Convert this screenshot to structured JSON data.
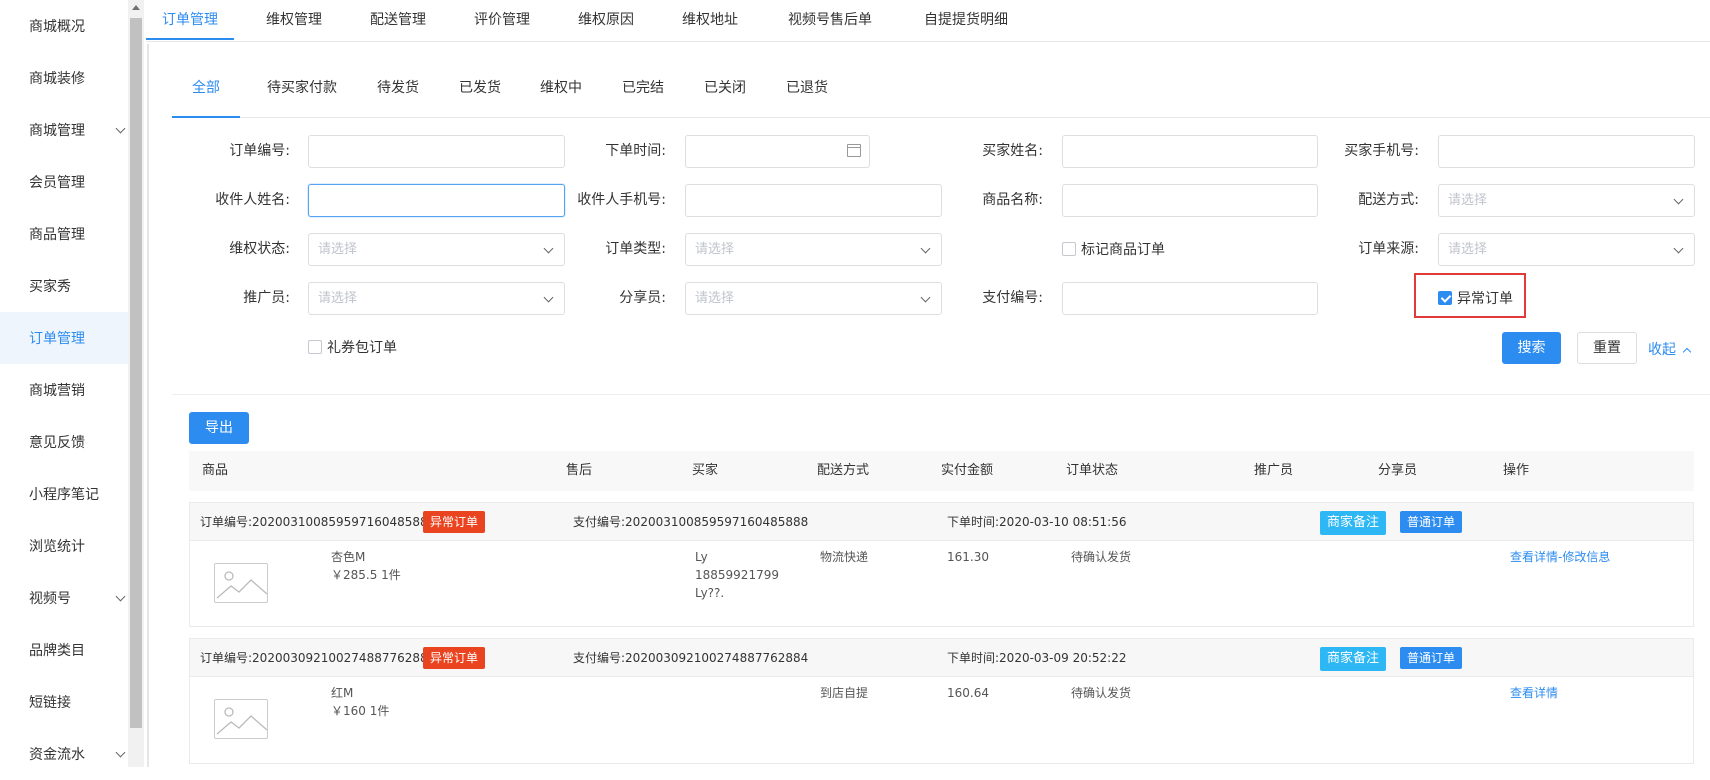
{
  "sidebar": {
    "items": [
      {
        "label": "商城概况"
      },
      {
        "label": "商城装修"
      },
      {
        "label": "商城管理"
      },
      {
        "label": "会员管理"
      },
      {
        "label": "商品管理"
      },
      {
        "label": "买家秀"
      },
      {
        "label": "订单管理"
      },
      {
        "label": "商城营销"
      },
      {
        "label": "意见反馈"
      },
      {
        "label": "小程序笔记"
      },
      {
        "label": "浏览统计"
      },
      {
        "label": "视频号"
      },
      {
        "label": "品牌类目"
      },
      {
        "label": "短链接"
      },
      {
        "label": "资金流水"
      }
    ],
    "active": "订单管理"
  },
  "top_tabs": [
    "订单管理",
    "维权管理",
    "配送管理",
    "评价管理",
    "维权原因",
    "维权地址",
    "视频号售后单",
    "自提提货明细"
  ],
  "sub_tabs": [
    "全部",
    "待买家付款",
    "待发货",
    "已发货",
    "维权中",
    "已完结",
    "已关闭",
    "已退货"
  ],
  "filters": {
    "order_no": "订单编号:",
    "order_time": "下单时间:",
    "buyer_name": "买家姓名:",
    "buyer_phone": "买家手机号:",
    "receiver_name": "收件人姓名:",
    "receiver_phone": "收件人手机号:",
    "product_name": "商品名称:",
    "delivery": "配送方式:",
    "rights_status": "维权状态:",
    "order_type": "订单类型:",
    "order_source": "订单来源:",
    "promoter": "推广员:",
    "sharer": "分享员:",
    "pay_no": "支付编号:",
    "placeholder": "请选择",
    "mark_order": "标记商品订单",
    "abnormal_order": "异常订单",
    "gift_order": "礼券包订单",
    "search": "搜索",
    "reset": "重置",
    "collapse": "收起"
  },
  "export_label": "导出",
  "table": {
    "headers": [
      "商品",
      "售后",
      "买家",
      "配送方式",
      "实付金额",
      "订单状态",
      "推广员",
      "分享员",
      "操作"
    ]
  },
  "orders": [
    {
      "order_no": "订单编号:20200310085959716048588​8",
      "abnormal_tag": "异常订单",
      "pay_no": "支付编号:20200310085959716048588​8",
      "order_time": "下单时间:2020-03-10 08:51:56",
      "merchant_note": "商家备注",
      "order_kind": "普通订单",
      "product": "杏色M",
      "price_qty": "￥285.5   1件",
      "buyer": [
        "Ly",
        "18859921799",
        "Ly??."
      ],
      "delivery": "物流快递",
      "amount": "161.30",
      "status": "待确认发货",
      "action": "查看详情-修改信息"
    },
    {
      "order_no": "订单编号:20200309210027488776288​4",
      "abnormal_tag": "异常订单",
      "pay_no": "支付编号:20200309210027488776288​4",
      "order_time": "下单时间:2020-03-09 20:52:22",
      "merchant_note": "商家备注",
      "order_kind": "普通订单",
      "product": "红M",
      "price_qty": "￥160   1件",
      "buyer": [],
      "delivery": "到店自提",
      "amount": "160.64",
      "status": "待确认发货",
      "action": "查看详情"
    }
  ],
  "colors": {
    "primary": "#2d8cf0",
    "abnormal_tag": "#e9431f",
    "note_tag": "#2db7f5",
    "highlight_box": "#e03a3a"
  }
}
